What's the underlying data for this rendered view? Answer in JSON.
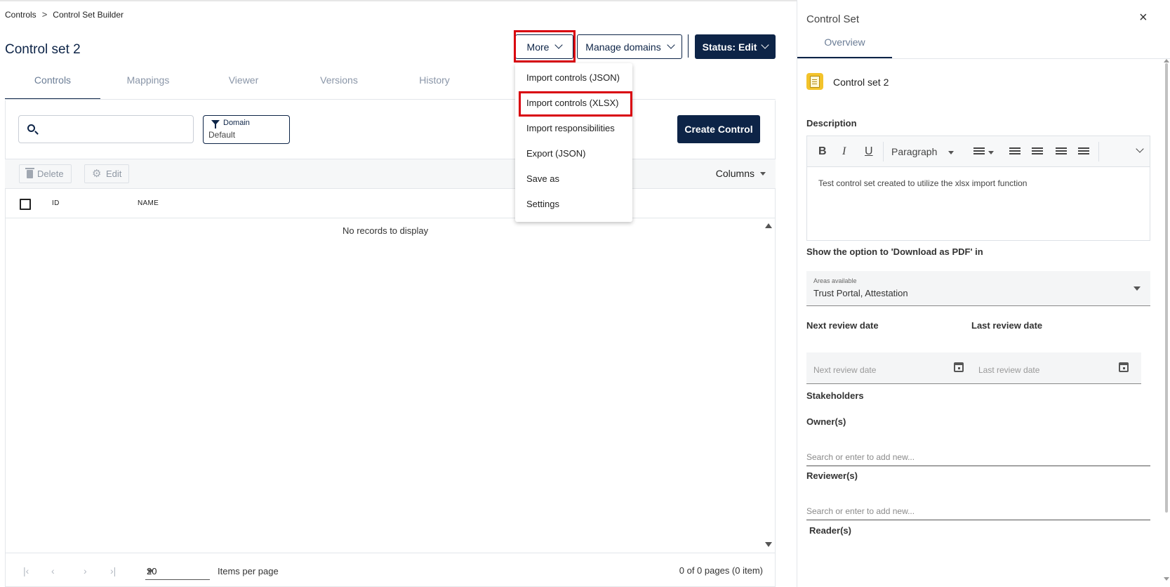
{
  "breadcrumb": {
    "root": "Controls",
    "separator": ">",
    "current": "Control Set Builder"
  },
  "page": {
    "title": "Control set 2"
  },
  "tabs": [
    {
      "label": "Controls"
    },
    {
      "label": "Mappings"
    },
    {
      "label": "Viewer"
    },
    {
      "label": "Versions"
    },
    {
      "label": "History"
    }
  ],
  "header_buttons": {
    "more": "More",
    "manage_domains": "Manage domains",
    "status": "Status: Edit"
  },
  "more_menu": [
    "Import controls (JSON)",
    "Import controls (XLSX)",
    "Import responsibilities",
    "Export (JSON)",
    "Save as",
    "Settings"
  ],
  "search": {
    "placeholder": ""
  },
  "domain_filter": {
    "label": "Domain",
    "value": "Default"
  },
  "create_button": "Create Control",
  "toolbar": {
    "delete": "Delete",
    "edit": "Edit",
    "columns": "Columns"
  },
  "table": {
    "columns": [
      "ID",
      "NAME"
    ],
    "empty_text": "No records to display"
  },
  "pagination": {
    "page_size": "20",
    "items_label": "Items per page",
    "info": "0 of 0 pages (0 item)"
  },
  "panel": {
    "title": "Control Set",
    "close": "×",
    "tab": "Overview",
    "entity_name": "Control set 2",
    "description_label": "Description",
    "editor": {
      "paragraph": "Paragraph",
      "text": "Test control set created to utilize the xlsx import function"
    },
    "pdf_label": "Show the option to 'Download as PDF' in",
    "areas": {
      "label": "Areas available",
      "value": "Trust Portal, Attestation"
    },
    "next_review": {
      "label": "Next review date",
      "placeholder": "Next review date"
    },
    "last_review": {
      "label": "Last review date",
      "placeholder": "Last review date"
    },
    "stakeholders_label": "Stakeholders",
    "owners": {
      "label": "Owner(s)",
      "placeholder": "Search or enter to add new..."
    },
    "reviewers": {
      "label": "Reviewer(s)",
      "placeholder": "Search or enter to add new..."
    },
    "readers": {
      "label": "Reader(s)"
    }
  },
  "colors": {
    "primary": "#0d2447",
    "highlight": "#d9000d",
    "doc_icon": "#f3c32b"
  }
}
